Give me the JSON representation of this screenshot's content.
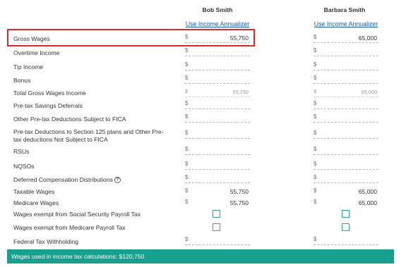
{
  "columns": [
    {
      "name": "Bob Smith",
      "annualizer_label": "Use Income Annualizer"
    },
    {
      "name": "Barbara Smith",
      "annualizer_label": "Use Income Annualizer"
    }
  ],
  "currency_symbol": "$",
  "rows": [
    {
      "label": "Gross Wages",
      "type": "input",
      "values": [
        "55,750",
        "65,000"
      ]
    },
    {
      "label": "Overtime Income",
      "type": "input",
      "values": [
        "",
        ""
      ]
    },
    {
      "label": "Tip Income",
      "type": "input",
      "values": [
        "",
        ""
      ]
    },
    {
      "label": "Bonus",
      "type": "input",
      "values": [
        "",
        ""
      ]
    },
    {
      "label": "Total Gross Wages Income",
      "type": "readonly",
      "values": [
        "55,750",
        "65,000"
      ]
    },
    {
      "label": "Pre-tax Savings Deferrals",
      "type": "input",
      "values": [
        "",
        ""
      ]
    },
    {
      "label": "Other Pre-tax Deductions Subject to FICA",
      "type": "input",
      "values": [
        "",
        ""
      ]
    },
    {
      "label": "Pre-tax Deductions to Section 125 plans and Other Pre-tax deductions Not Subject to FICA",
      "label_line1": "Pre-tax Deductions to Section 125 plans and Other Pre-",
      "label_line2": "tax deductions Not Subject to FICA",
      "type": "input",
      "values": [
        "",
        ""
      ]
    },
    {
      "label": "RSUs",
      "type": "input",
      "values": [
        "",
        ""
      ]
    },
    {
      "label": "NQSOs",
      "type": "input",
      "values": [
        "",
        ""
      ]
    },
    {
      "label": "Deferred Compensation Distributions",
      "type": "input",
      "help_icon": "question-circle-icon",
      "values": [
        "",
        ""
      ]
    },
    {
      "label": "Taxable Wages",
      "type": "display",
      "values": [
        "55,750",
        "65,000"
      ]
    },
    {
      "label": "Medicare Wages",
      "type": "display",
      "values": [
        "55,750",
        "65,000"
      ]
    },
    {
      "label": "Wages exempt from Social Security Payroll Tax",
      "type": "checkbox",
      "values": [
        false,
        false
      ]
    },
    {
      "label": "Wages exempt from Medicare Payroll Tax",
      "type": "checkbox",
      "values": [
        false,
        false
      ]
    },
    {
      "label": "Federal Tax Withholding",
      "type": "input",
      "values": [
        "",
        ""
      ]
    }
  ],
  "footer": {
    "text": "Wages used in income tax calculations: $120,750"
  },
  "colors": {
    "accent": "#17a08e",
    "link": "#1a5ea8",
    "highlight": "#d62b2b",
    "checkbox": "#2aa79a"
  }
}
